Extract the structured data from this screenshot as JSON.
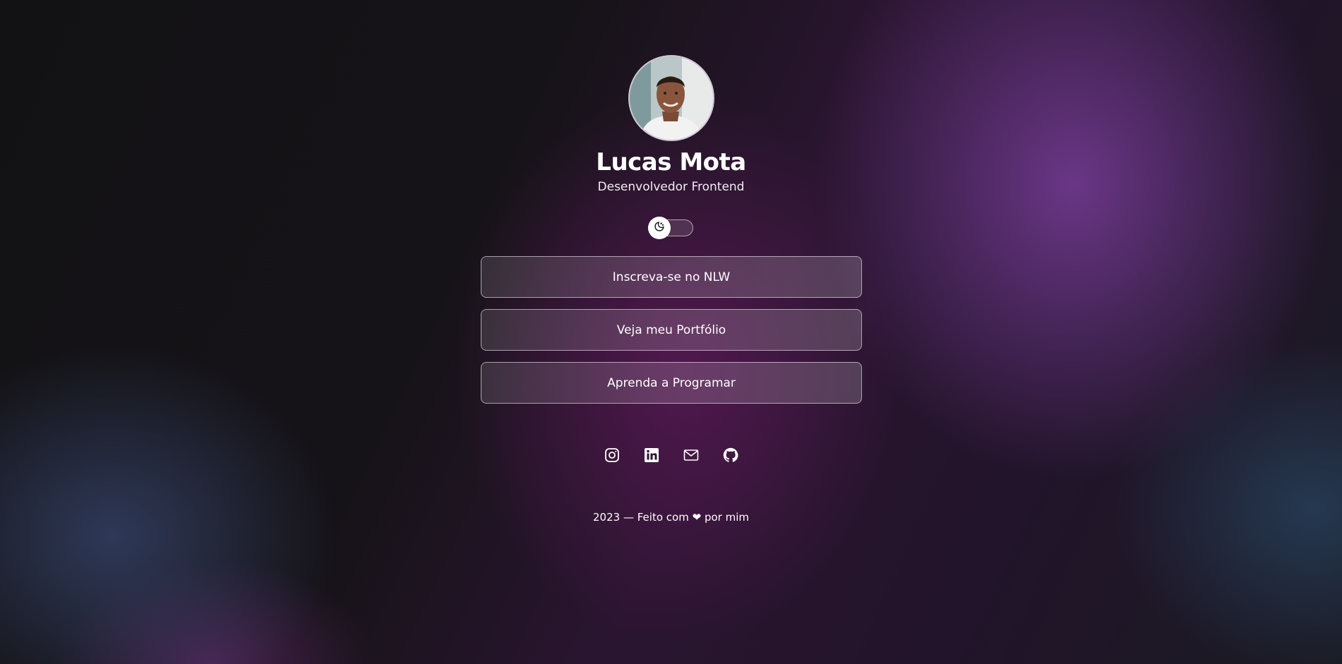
{
  "profile": {
    "name": "Lucas Mota",
    "role": "Desenvolvedor Frontend"
  },
  "theme_switch": {
    "icon": "moon-icon",
    "state": "dark"
  },
  "links": [
    {
      "label": "Inscreva-se no NLW"
    },
    {
      "label": "Veja meu Portfólio"
    },
    {
      "label": "Aprenda a Programar"
    }
  ],
  "social": [
    {
      "icon": "instagram-icon"
    },
    {
      "icon": "linkedin-icon"
    },
    {
      "icon": "mail-icon"
    },
    {
      "icon": "github-icon"
    }
  ],
  "footer": {
    "year": "2023",
    "text_before_heart": "— Feito com",
    "heart": "❤",
    "text_after_heart": "por mim"
  },
  "colors": {
    "background": "#121214",
    "accent_purple": "#763c96",
    "text": "#ffffff"
  }
}
